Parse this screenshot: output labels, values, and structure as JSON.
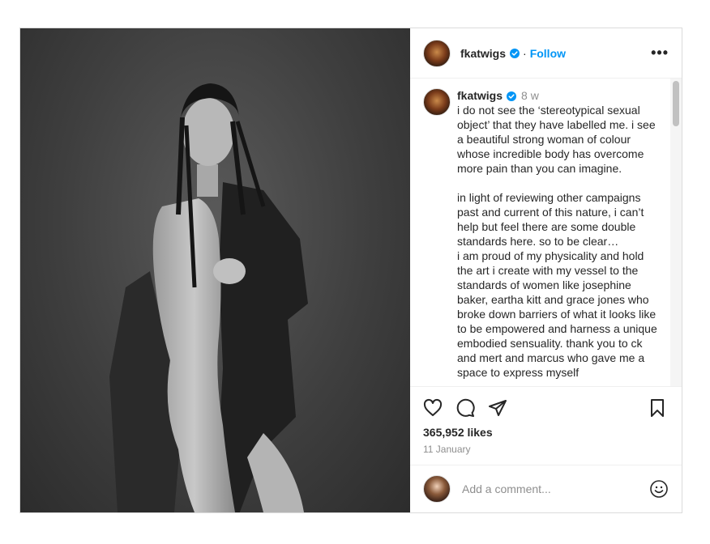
{
  "post": {
    "username": "fkatwigs",
    "separator": "·",
    "follow_label": "Follow",
    "more_label": "•••",
    "caption": {
      "username": "fkatwigs",
      "time": "8 w",
      "paragraph1": "i do not see the ‘stereotypical sexual object’ that they have labelled me. i see a beautiful strong woman of colour whose incredible body has overcome more pain than you can imagine.",
      "paragraph2": "in light of reviewing other campaigns past and current of this nature, i can’t help but feel there are some double standards here. so to be clear…\ni am proud of my physicality and hold the art i create with my vessel to the standards of women like josephine baker, eartha kitt and grace jones who broke down barriers of what it looks like to be empowered and harness a unique embodied sensuality. thank you to ck and mert and marcus who gave me a space to express myself"
    },
    "likes": "365,952 likes",
    "date": "11 January",
    "comment_placeholder": "Add a comment..."
  },
  "colors": {
    "accent": "#0095f6",
    "verified": "#0095f6",
    "muted": "#8e8e8e",
    "text": "#262626",
    "border": "#dbdbdb"
  },
  "icons": {
    "verified": "verified-badge-icon",
    "more": "more-horizontal-icon",
    "like": "heart-icon",
    "comment": "comment-bubble-icon",
    "share": "paper-plane-icon",
    "save": "bookmark-icon",
    "emoji": "smiley-icon"
  }
}
